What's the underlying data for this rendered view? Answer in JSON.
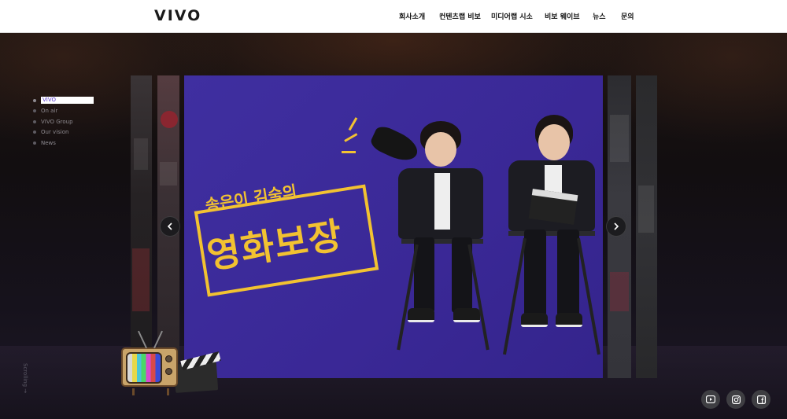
{
  "header": {
    "logo": "VIVO",
    "nav": [
      {
        "label": "회사소개"
      },
      {
        "label": "컨텐츠랩 비보"
      },
      {
        "label": "미디어랩 시소"
      },
      {
        "label": "비보 웨이브"
      },
      {
        "label": "뉴스"
      },
      {
        "label": "문의"
      }
    ]
  },
  "side_nav": {
    "items": [
      {
        "label": "VIVO",
        "active": true
      },
      {
        "label": "On air",
        "active": false
      },
      {
        "label": "VIVO Group",
        "active": false
      },
      {
        "label": "Our vision",
        "active": false
      },
      {
        "label": "News",
        "active": false
      }
    ]
  },
  "scroll_indicator": "Scrolling →",
  "slide": {
    "title_small": "송은이 김숙의",
    "title_big": "영화보장"
  },
  "social": [
    {
      "icon": "youtube-icon"
    },
    {
      "icon": "instagram-icon"
    },
    {
      "icon": "facebook-icon"
    }
  ],
  "colors": {
    "accent": "#5b3ad1",
    "slide_bg": "#3a2896",
    "title_yellow": "#f2c231"
  }
}
